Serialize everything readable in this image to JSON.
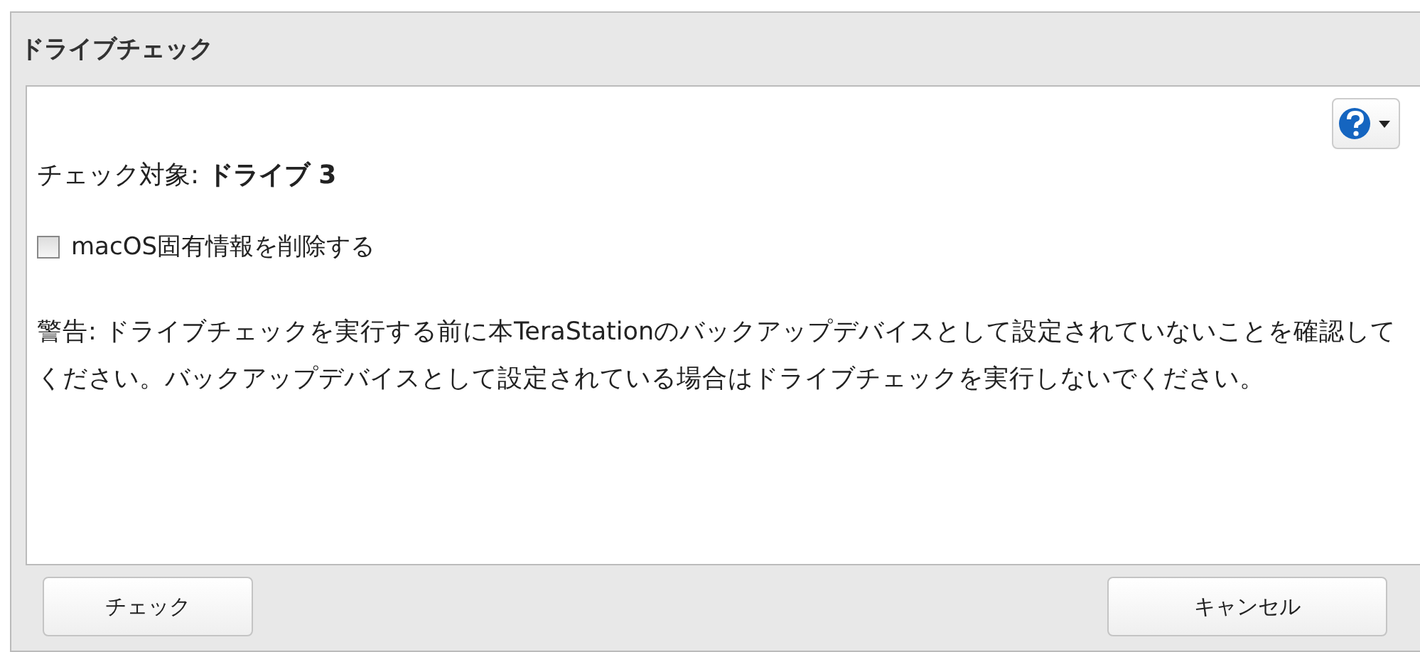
{
  "dialog": {
    "title": "ドライブチェック"
  },
  "target_label": "チェック対象: **ドライブ 3**",
  "checkbox": {
    "label": "macOS固有情報を削除する",
    "checked": false
  },
  "warning": "警告: ドライブチェックを実行する前に本TeraStationのバックアップデバイスとして設定されていないことを確認してください。バックアップデバイスとして設定されている場合はドライブチェックを実行しないでください。",
  "buttons": [
    {
      "label": "チェック",
      "kind": "check"
    },
    {
      "label": "キャンセル",
      "kind": "cancel"
    }
  ]
}
